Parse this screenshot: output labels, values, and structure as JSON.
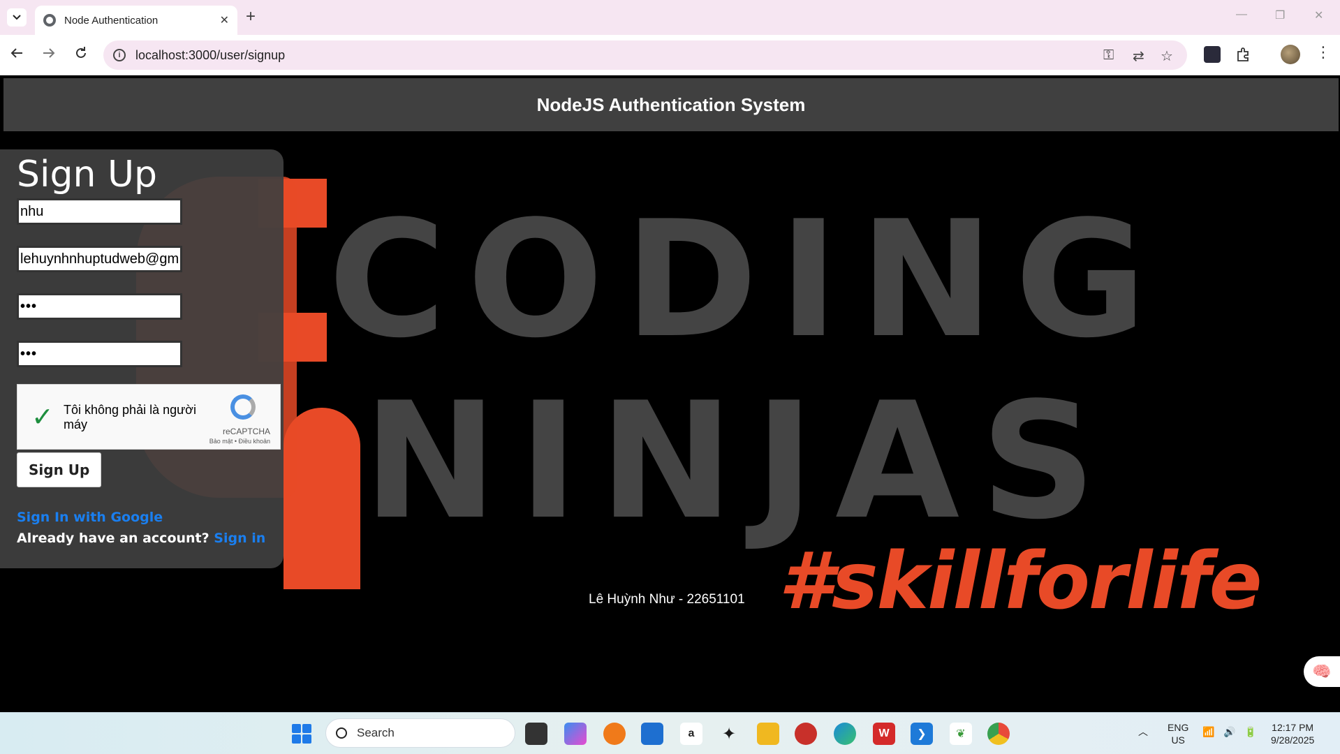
{
  "browser": {
    "tab_title": "Node Authentication",
    "url": "localhost:3000/user/signup"
  },
  "header": {
    "title": "NodeJS Authentication System"
  },
  "background": {
    "line1": "CODING",
    "line2": "NINJAS",
    "tagline": "#skillforlife",
    "accent_color": "#e84a27"
  },
  "signup": {
    "heading": "Sign Up",
    "name_value": "nhu",
    "email_value": "lehuynhnhuptudweb@gm",
    "password_value": "•••",
    "confirm_value": "•••",
    "captcha_label": "Tôi không phải là người máy",
    "captcha_brand": "reCAPTCHA",
    "captcha_terms": "Bảo mật • Điều khoản",
    "submit_label": "Sign Up",
    "google_link": "Sign In with Google",
    "already_text": "Already have an account?",
    "signin_link": "Sign in"
  },
  "footer": {
    "author": "Lê Huỳnh Như - 22651101"
  },
  "taskbar": {
    "search_label": "Search",
    "lang_top": "ENG",
    "lang_bottom": "US",
    "time": "12:17 PM",
    "date": "9/28/2025"
  }
}
